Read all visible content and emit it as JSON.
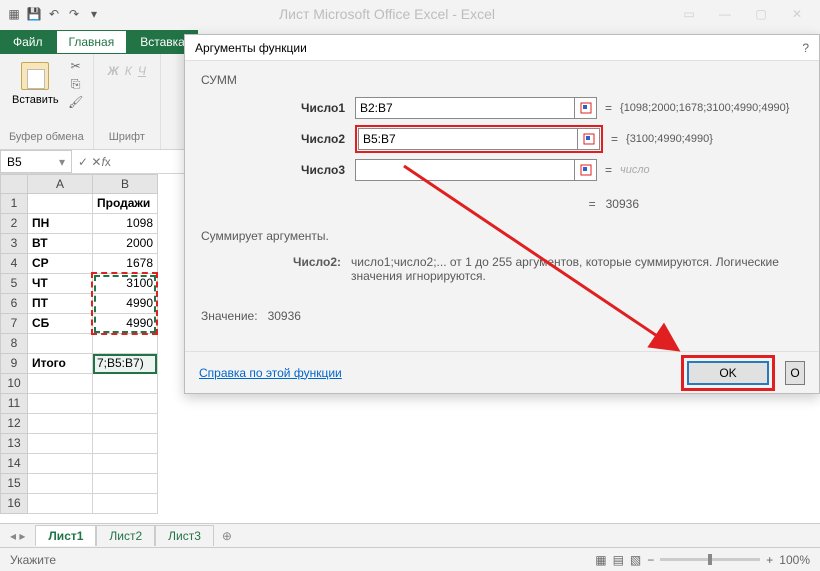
{
  "app": {
    "title": "Лист Microsoft Office Excel - Excel"
  },
  "tabs": {
    "file": "Файл",
    "home": "Главная",
    "insert": "Вставка"
  },
  "ribbon": {
    "paste": "Вставить",
    "clipboard_group": "Буфер обмена",
    "font_group": "Шрифт",
    "bold": "Ж",
    "italic": "К",
    "underline": "Ч"
  },
  "namebox": "B5",
  "colheaders": [
    "A",
    "B"
  ],
  "rows": [
    {
      "n": "1",
      "a": "",
      "b": "Продажи",
      "bold": true
    },
    {
      "n": "2",
      "a": "ПН",
      "b": "1098"
    },
    {
      "n": "3",
      "a": "ВТ",
      "b": "2000"
    },
    {
      "n": "4",
      "a": "СР",
      "b": "1678"
    },
    {
      "n": "5",
      "a": "ЧТ",
      "b": "3100"
    },
    {
      "n": "6",
      "a": "ПТ",
      "b": "4990"
    },
    {
      "n": "7",
      "a": "СБ",
      "b": "4990"
    },
    {
      "n": "8",
      "a": "",
      "b": ""
    },
    {
      "n": "9",
      "a": "Итого",
      "b": "7;B5:B7)"
    },
    {
      "n": "10",
      "a": "",
      "b": ""
    },
    {
      "n": "11",
      "a": "",
      "b": ""
    },
    {
      "n": "12",
      "a": "",
      "b": ""
    },
    {
      "n": "13",
      "a": "",
      "b": ""
    },
    {
      "n": "14",
      "a": "",
      "b": ""
    },
    {
      "n": "15",
      "a": "",
      "b": ""
    },
    {
      "n": "16",
      "a": "",
      "b": ""
    }
  ],
  "dialog": {
    "title": "Аргументы функции",
    "help": "?",
    "fn": "СУММ",
    "args": [
      {
        "label": "Число1",
        "value": "B2:B7",
        "preview": "{1098;2000;1678;3100;4990;4990}"
      },
      {
        "label": "Число2",
        "value": "B5:B7",
        "preview": "{3100;4990;4990}"
      },
      {
        "label": "Число3",
        "value": "",
        "preview": "число"
      }
    ],
    "result_eq": "=",
    "result": "30936",
    "desc": "Суммирует аргументы.",
    "arg_name": "Число2:",
    "arg_desc": "число1;число2;... от 1 до 255 аргументов, которые суммируются. Логические значения игнорируются.",
    "value_label": "Значение:",
    "value": "30936",
    "help_link": "Справка по этой функции",
    "ok": "OK",
    "cancel": "О"
  },
  "sheets": {
    "s1": "Лист1",
    "s2": "Лист2",
    "s3": "Лист3",
    "add": "⊕"
  },
  "status": {
    "mode": "Укажите",
    "zoom": "100%"
  }
}
